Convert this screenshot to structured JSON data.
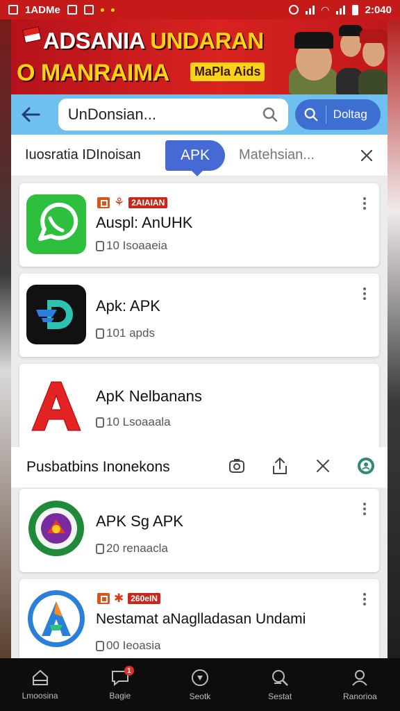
{
  "status_bar": {
    "left_text": "1ADMe",
    "time": "2:040"
  },
  "banner": {
    "title_line1_white": "ADSANIA ",
    "title_line1_yellow": "UNDARAN",
    "title_line2": "O MANRAIMA",
    "tag": "MaPla Aids"
  },
  "search": {
    "query": "UnDonsian...",
    "button_label": "Doltag"
  },
  "tabs": [
    {
      "label": "Iuosratia IDInoisan"
    },
    {
      "label": "APK"
    },
    {
      "label": "Matehsian..."
    }
  ],
  "apps_top": [
    {
      "badge_text": "2AIAIAN",
      "name": "Auspl: AnUHK",
      "sub": "10 Isoaaeia",
      "icon": "whatsapp-style-icon"
    },
    {
      "name": "Apk: APK",
      "sub": "101 apds",
      "icon": "d-logo-icon"
    },
    {
      "name": "ApK Nelbanans",
      "sub": "10 Lsoaaala",
      "icon": "red-a-icon"
    }
  ],
  "section": {
    "title": "Pusbatbins Inonekons"
  },
  "apps_bottom": [
    {
      "name": "APK Sg APK",
      "sub": "20 renaacla",
      "icon": "emblem-icon"
    },
    {
      "badge_text": "260eIN",
      "name": "Nestamat aNaglladasan Undami",
      "sub": "00 Ieoasia",
      "icon": "blue-a-icon"
    }
  ],
  "bottom_nav": [
    {
      "label": "Lmoosina",
      "icon": "home-icon"
    },
    {
      "label": "Bagie",
      "icon": "chat-icon",
      "badge": "1"
    },
    {
      "label": "Seotk",
      "icon": "circle-icon"
    },
    {
      "label": "Sestat",
      "icon": "search-user-icon"
    },
    {
      "label": "Ranorioa",
      "icon": "profile-icon"
    }
  ],
  "colors": {
    "banner_red": "#c41a1a",
    "search_bar": "#6fc0ef",
    "primary_blue": "#4669d4",
    "bottom_nav": "#0d0d0d"
  }
}
